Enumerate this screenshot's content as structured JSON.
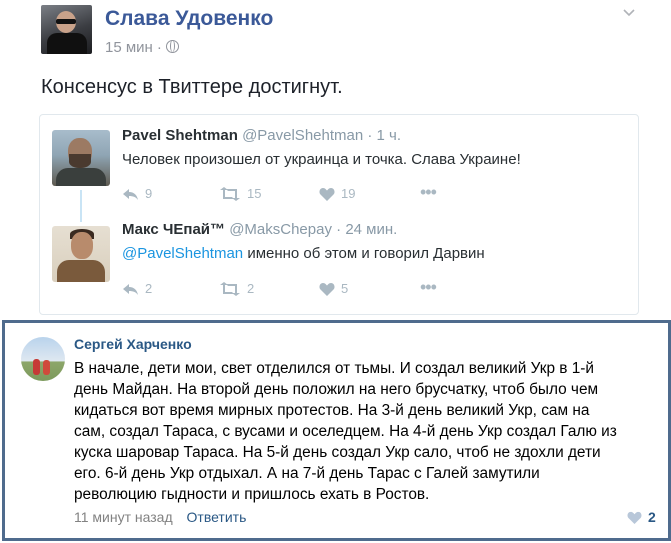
{
  "post": {
    "author": "Слава Удовенко",
    "time": "15 мин",
    "separator": "·",
    "text": "Консенсус в Твиттере достигнут."
  },
  "tweets": [
    {
      "name": "Pavel Shehtman",
      "handle": "@PavelShehtman",
      "sep": "·",
      "time": "1 ч.",
      "text": "Человек произошел от украинца и точка. Слава Украине!",
      "replies": "9",
      "retweets": "15",
      "likes": "19"
    },
    {
      "name": "Макс ЧЕпай™",
      "handle": "@MaksChepay",
      "sep": "·",
      "time": "24 мин.",
      "mention": "@PavelShehtman",
      "text": "именно об этом и говорил Дарвин",
      "replies": "2",
      "retweets": "2",
      "likes": "5"
    }
  ],
  "comment": {
    "author": "Сергей Харченко",
    "lines": [
      "В начале, дети мои, свет отделился от тьмы. И создал великий Укр в 1-й",
      "день Майдан. На второй день положил на него брусчатку, чтоб было чем",
      "кидаться вот время мирных протестов. На 3-й день великий Укр, сам на",
      "сам, создал Тараса, с вусами и оселедцем. На 4-й день Укр создал Галю из",
      "куска шаровар Тараса. На 5-й день создал Укр сало, чтоб не здохли дети",
      "его. 6-й день Укр отдыхал. А на 7-й день Тарас с Галей замутили",
      "революцию гыдности и пришлось ехать в Ростов."
    ],
    "time": "11 минут назад",
    "reply_label": "Ответить",
    "likes": "2"
  },
  "colors": {
    "fb_link": "#3b5998",
    "twitter_link": "#1b95e0",
    "vk_link": "#2a5885",
    "vk_frame": "#4f6b8d"
  },
  "icons": [
    "globe-icon",
    "chevron-down-icon",
    "reply-icon",
    "retweet-icon",
    "heart-icon",
    "more-icon",
    "vk-heart-icon"
  ]
}
